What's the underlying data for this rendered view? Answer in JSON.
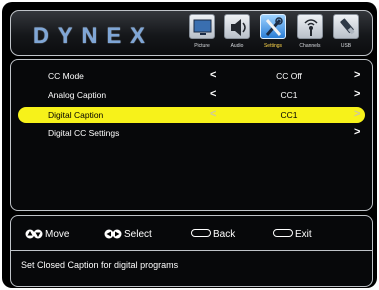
{
  "brand": {
    "logo": "DYNEX"
  },
  "tabs": [
    {
      "label": "Picture",
      "icon": "tv-picture-icon",
      "active": false
    },
    {
      "label": "Audio",
      "icon": "speaker-audio-icon",
      "active": false
    },
    {
      "label": "Settings",
      "icon": "tools-settings-icon",
      "active": true
    },
    {
      "label": "Channels",
      "icon": "antenna-channels-icon",
      "active": false
    },
    {
      "label": "USB",
      "icon": "usb-icon",
      "active": false
    }
  ],
  "menu": {
    "items": [
      {
        "label": "CC Mode",
        "value": "CC Off",
        "left_arrow": "<",
        "right_arrow": ">",
        "selected": false
      },
      {
        "label": "Analog Caption",
        "value": "CC1",
        "left_arrow": "<",
        "right_arrow": ">",
        "selected": false
      },
      {
        "label": "Digital Caption",
        "value": "CC1",
        "left_arrow": "<",
        "right_arrow": ">",
        "selected": true
      },
      {
        "label": "Digital CC Settings",
        "value": "",
        "left_arrow": "",
        "right_arrow": ">",
        "selected": false
      }
    ]
  },
  "footer": {
    "move": "Move",
    "select": "Select",
    "back": "Back",
    "exit": "Exit",
    "description": "Set Closed Caption for digital programs"
  },
  "colors": {
    "highlight": "#f7f21a",
    "logo": "#7fa6d6",
    "active_tab": "#2c7ed6",
    "active_tab_label": "#ffd74a"
  }
}
